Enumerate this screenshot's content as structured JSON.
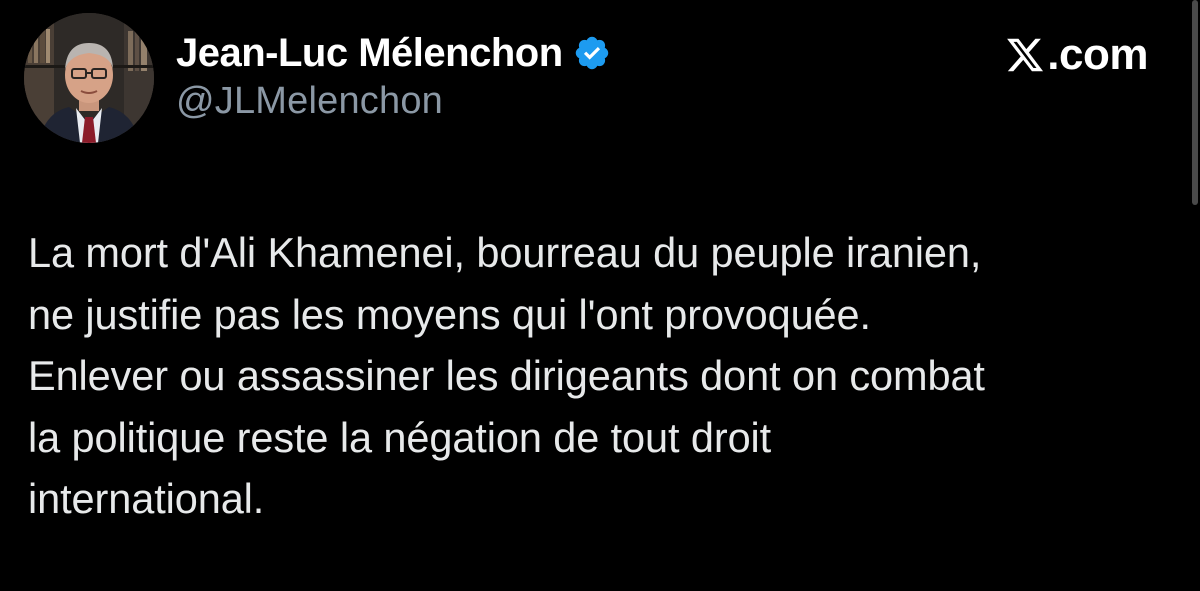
{
  "tweet": {
    "author": {
      "name": "Jean-Luc Mélenchon",
      "handle": "@JLMelenchon",
      "verified": true,
      "avatar_icon": "profile-photo"
    },
    "brand": {
      "logo_icon": "x-logo-icon",
      "domain": ".com"
    },
    "text_lines": [
      "La mort d'Ali Khamenei, bourreau du peuple iranien,",
      "ne justifie pas les moyens qui l'ont provoquée.",
      "Enlever ou assassiner les dirigeants dont on combat",
      "la politique reste la négation de tout droit",
      "international."
    ]
  },
  "colors": {
    "background": "#000000",
    "name": "#ffffff",
    "handle": "#8b98a5",
    "body_text": "#e7e9ea",
    "verified_badge": "#1d9bf0"
  }
}
